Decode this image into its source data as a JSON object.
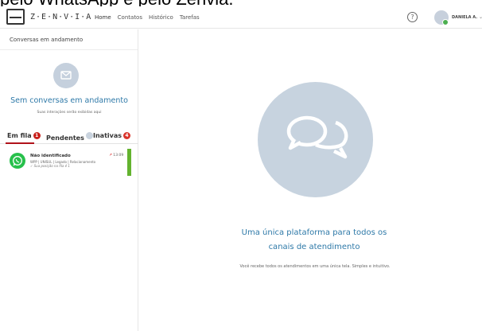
{
  "caption": "pelo WhatsApp e pelo Zenvia.",
  "brand": {
    "name": "Z·E·N·V·I·A"
  },
  "nav": [
    "Home",
    "Contatos",
    "Histórico",
    "Tarefas"
  ],
  "header": {
    "help_icon": "?",
    "user_name": "DANIELA A.",
    "caret": "⌄"
  },
  "sidebar": {
    "title": "Conversas em andamento",
    "empty_title": "Sem conversas em andamento",
    "empty_subtitle": "Suas interações serão exibidas aqui",
    "tabs": [
      {
        "label": "Em fila",
        "count": "1",
        "color": "#c8211c"
      },
      {
        "label": "Pendentes",
        "count": "",
        "color": "#c9d3de"
      },
      {
        "label": "Inativas",
        "count": "4",
        "color": "#d9342b"
      }
    ],
    "conversation": {
      "name": "Não identificado",
      "meta": "WPP | UNISUL | Legado | Relacionamento",
      "status": "Sua posição na fila é 1",
      "time": "13:09",
      "channel_icon": "whatsapp-icon"
    }
  },
  "main": {
    "title_line1": "Uma única plataforma para todos os",
    "title_line2": "canais de atendimento",
    "subtitle": "Você recebe todos os atendimentos em uma única tela. Simples e intuitivo.",
    "icon": "chat-bubbles-icon"
  },
  "colors": {
    "accent": "#2e79a8",
    "active_tab": "#b0121b",
    "whatsapp": "#27c04b",
    "status_bar": "#63b32f"
  }
}
